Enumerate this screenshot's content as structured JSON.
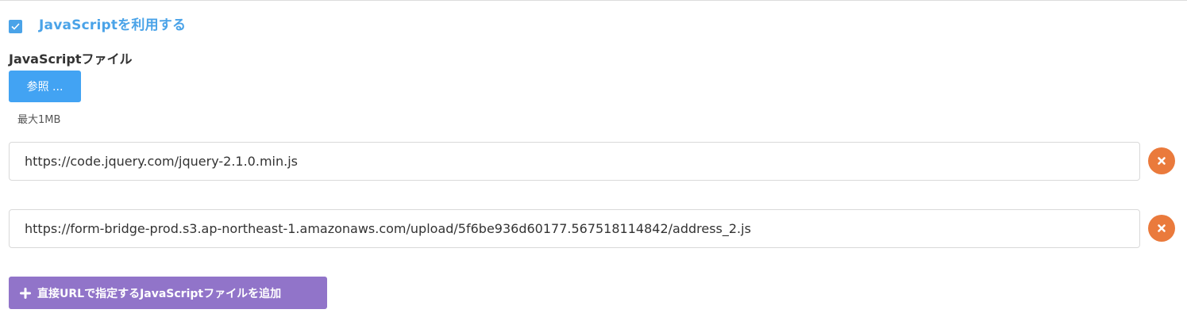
{
  "js_toggle": {
    "label": "JavaScriptを利用する",
    "checked": true,
    "color": "#4aa3e8"
  },
  "file_section": {
    "label": "JavaScriptファイル",
    "browse_label": "参照 ...",
    "size_note": "最大1MB"
  },
  "url_entries": [
    {
      "value": "https://code.jquery.com/jquery-2.1.0.min.js",
      "remove_icon": "close-icon"
    },
    {
      "value": "https://form-bridge-prod.s3.ap-northeast-1.amazonaws.com/upload/5f6be936d60177.567518114842/address_2.js",
      "remove_icon": "close-icon"
    }
  ],
  "add_url_button": {
    "label": "直接URLで指定するJavaScriptファイルを追加",
    "icon": "plus-icon",
    "color": "#9174c9"
  },
  "colors": {
    "browse_button": "#42a3f3",
    "remove_button": "#ea7a3c"
  }
}
